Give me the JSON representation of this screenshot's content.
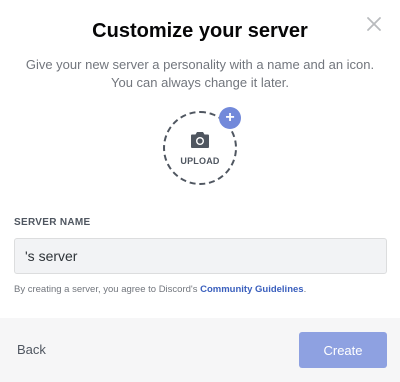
{
  "modal": {
    "title": "Customize your server",
    "subtitle": "Give your new server a personality with a name and an icon. You can always change it later.",
    "close_icon": "close-icon"
  },
  "upload": {
    "label": "UPLOAD",
    "camera_icon": "camera-icon",
    "plus_icon": "plus-icon",
    "plus_glyph": "+",
    "accent": "#7289da"
  },
  "form": {
    "server_name_label": "SERVER NAME",
    "server_name_value": "'s server"
  },
  "terms": {
    "prefix": "By creating a server, you agree to Discord's ",
    "link": "Community Guidelines",
    "suffix": "."
  },
  "footer": {
    "back_label": "Back",
    "create_label": "Create",
    "create_color": "#8ea1e1"
  }
}
